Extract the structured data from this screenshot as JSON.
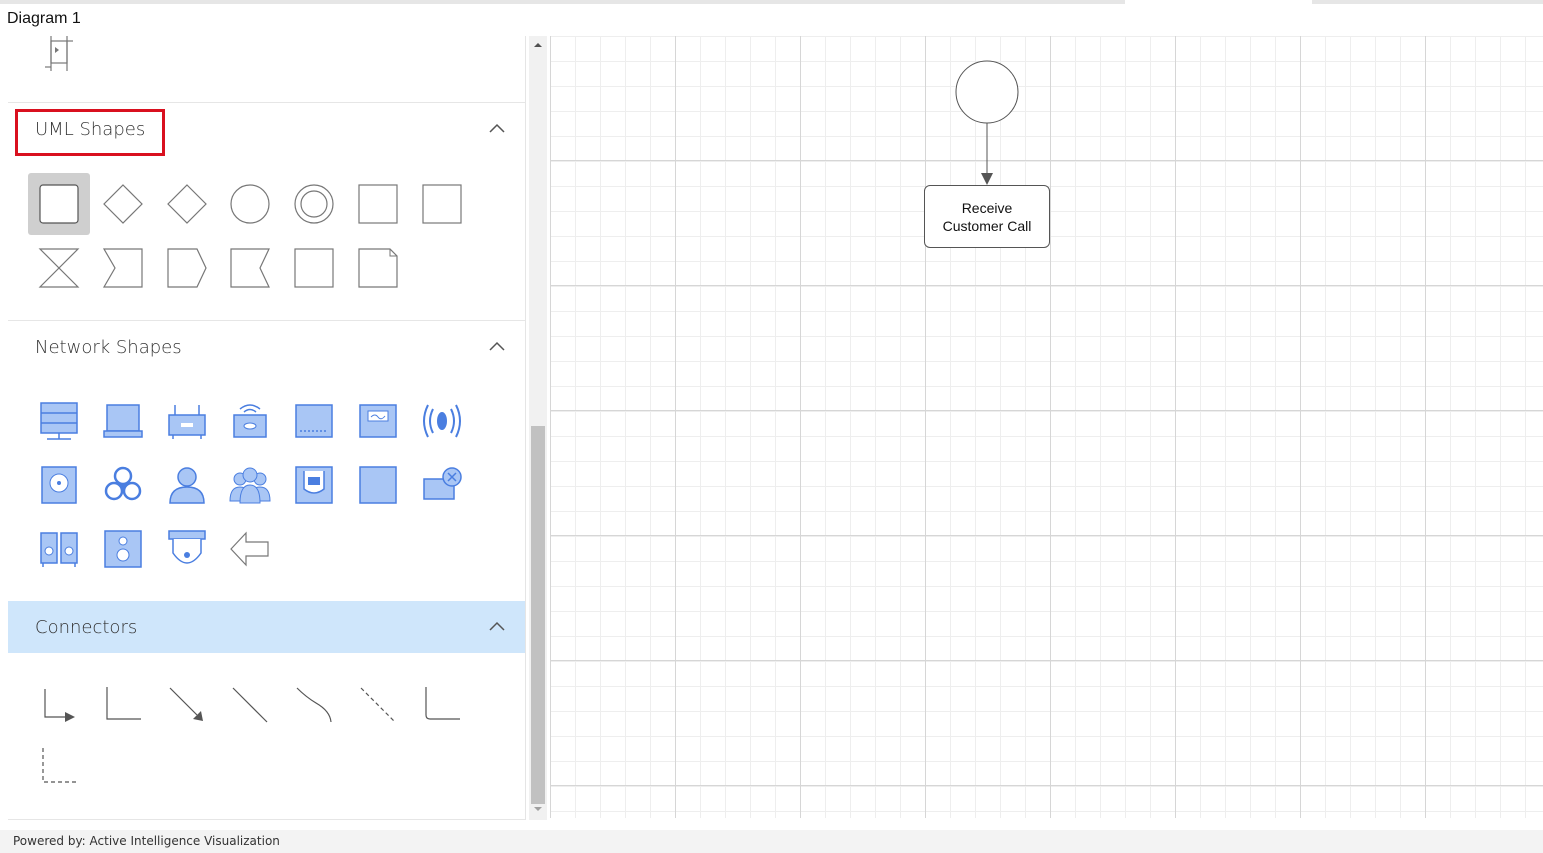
{
  "window": {
    "title": "Diagram 1"
  },
  "palette": {
    "sections": {
      "uml": {
        "label": "UML Shapes",
        "highlight_color": "#d9101f"
      },
      "network": {
        "label": "Network Shapes",
        "icon_color": "#5b8def"
      },
      "connectors": {
        "label": "Connectors",
        "header_bg": "#cfe6fb"
      }
    }
  },
  "diagram": {
    "nodes": [
      {
        "type": "start-circle"
      },
      {
        "type": "activity",
        "label_line1": "Receive",
        "label_line2": "Customer Call"
      }
    ]
  },
  "footer": {
    "text": "Powered by: Active Intelligence Visualization"
  }
}
